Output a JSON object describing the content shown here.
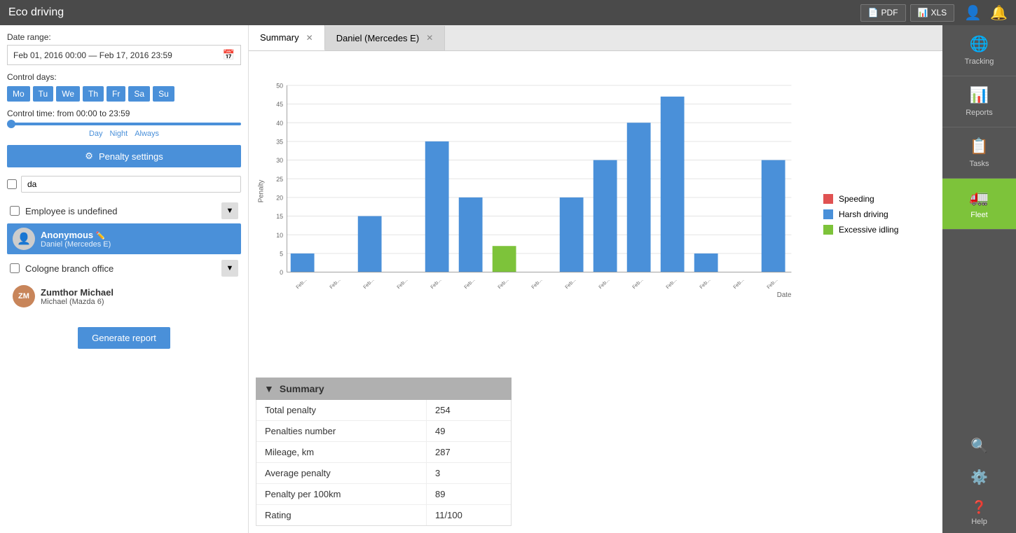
{
  "app": {
    "title": "Eco driving"
  },
  "toolbar": {
    "pdf_label": "PDF",
    "xls_label": "XLS"
  },
  "left_panel": {
    "date_range_label": "Date range:",
    "date_range_value": "Feb 01, 2016 00:00 — Feb 17, 2016 23:59",
    "control_days_label": "Control days:",
    "days": [
      "Mo",
      "Tu",
      "We",
      "Th",
      "Fr",
      "Sa",
      "Su"
    ],
    "control_time_label": "Control time: from 00:00 to 23:59",
    "time_options": [
      "Day",
      "Night",
      "Always"
    ],
    "penalty_settings_label": "Penalty settings",
    "search_placeholder": "da",
    "employee_undefined_label": "Employee is undefined",
    "groups": [
      {
        "name": "Anonymous",
        "vehicle": "Daniel (Mercedes E)",
        "active": true,
        "has_edit": true
      }
    ],
    "branches": [
      {
        "name": "Cologne branch office",
        "drivers": [
          {
            "name": "Zumthor Michael",
            "vehicle": "Michael (Mazda 6)"
          }
        ]
      }
    ],
    "generate_btn_label": "Generate report"
  },
  "tabs": [
    {
      "label": "Summary",
      "active": true,
      "closable": true
    },
    {
      "label": "Daniel (Mercedes E)",
      "active": false,
      "closable": true
    }
  ],
  "chart": {
    "y_axis_label": "Penalty",
    "x_axis_label": "Date",
    "y_max": 50,
    "y_ticks": [
      0,
      5,
      10,
      15,
      20,
      25,
      30,
      35,
      40,
      45,
      50
    ],
    "bars": [
      {
        "label": "Feb...",
        "value": 5,
        "color": "#4a90d9"
      },
      {
        "label": "Feb...",
        "value": 0,
        "color": "#4a90d9"
      },
      {
        "label": "Feb...",
        "value": 15,
        "color": "#4a90d9"
      },
      {
        "label": "Feb...",
        "value": 0,
        "color": "#4a90d9"
      },
      {
        "label": "Feb...",
        "value": 35,
        "color": "#4a90d9"
      },
      {
        "label": "Feb...",
        "value": 20,
        "color": "#4a90d9"
      },
      {
        "label": "Feb...",
        "value": 7,
        "color": "#7dc33a"
      },
      {
        "label": "Feb...",
        "value": 0,
        "color": "#4a90d9"
      },
      {
        "label": "Feb...",
        "value": 20,
        "color": "#4a90d9"
      },
      {
        "label": "Feb...",
        "value": 30,
        "color": "#4a90d9"
      },
      {
        "label": "Feb...",
        "value": 40,
        "color": "#4a90d9"
      },
      {
        "label": "Feb...",
        "value": 47,
        "color": "#4a90d9"
      },
      {
        "label": "Feb...",
        "value": 5,
        "color": "#4a90d9"
      },
      {
        "label": "Feb...",
        "value": 0,
        "color": "#4a90d9"
      },
      {
        "label": "Feb...",
        "value": 30,
        "color": "#4a90d9"
      }
    ],
    "legend": [
      {
        "label": "Speeding",
        "color": "#e05252"
      },
      {
        "label": "Harsh driving",
        "color": "#4a90d9"
      },
      {
        "label": "Excessive idling",
        "color": "#7dc33a"
      }
    ]
  },
  "summary": {
    "header": "Summary",
    "rows": [
      {
        "label": "Total penalty",
        "value": "254"
      },
      {
        "label": "Penalties number",
        "value": "49"
      },
      {
        "label": "Mileage, km",
        "value": "287"
      },
      {
        "label": "Average penalty",
        "value": "3"
      },
      {
        "label": "Penalty per 100km",
        "value": "89"
      },
      {
        "label": "Rating",
        "value": "11/100"
      }
    ]
  },
  "right_sidebar": {
    "items": [
      {
        "label": "Tracking",
        "icon": "🌐",
        "active": false
      },
      {
        "label": "Reports",
        "icon": "📊",
        "active": false
      },
      {
        "label": "Tasks",
        "icon": "📋",
        "active": false
      },
      {
        "label": "Fleet",
        "icon": "🚛",
        "active": true
      }
    ],
    "bottom_items": [
      {
        "label": "",
        "icon": "🔍"
      },
      {
        "label": "",
        "icon": "⚙️"
      }
    ],
    "help_label": "Help"
  }
}
